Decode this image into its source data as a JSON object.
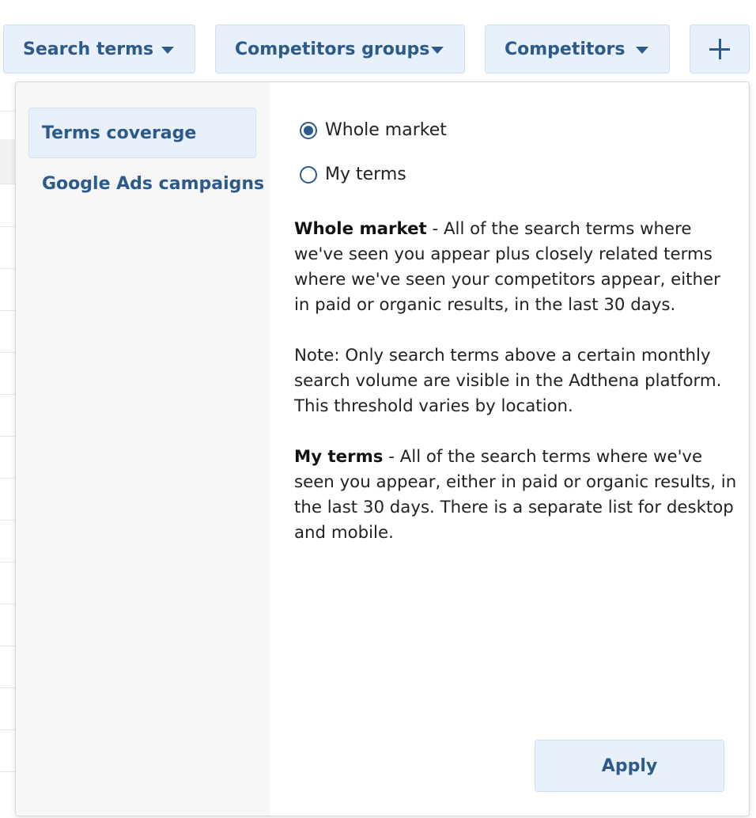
{
  "filters": {
    "search_terms_label": "Search terms",
    "competitor_groups_label": "Competitors groups",
    "competitors_label": "Competitors",
    "add_icon": "plus-icon"
  },
  "dropdown": {
    "sidebar": {
      "items": [
        {
          "label": "Terms coverage",
          "active": true
        },
        {
          "label": "Google Ads campaigns",
          "active": false
        }
      ]
    },
    "options": [
      {
        "label": "Whole market",
        "selected": true
      },
      {
        "label": "My terms",
        "selected": false
      }
    ],
    "description": {
      "whole_market_title": "Whole market",
      "whole_market_text": " - All of the search terms where we've seen you appear plus closely related terms where we've seen your competitors appear, either in paid or organic results, in the last 30 days.",
      "note_text": "Note: Only search terms above a certain monthly search volume are visible in the Adthena platform. This threshold varies by location.",
      "my_terms_title": "My terms",
      "my_terms_text": " - All of the search terms where we've seen you appear, either in paid or organic results, in the last 30 days. There is a separate list for desktop and mobile."
    },
    "apply_label": "Apply"
  },
  "colors": {
    "accent": "#2c5a8c",
    "button_bg": "#e8f1fb",
    "sidebar_bg": "#f7f7f8"
  }
}
